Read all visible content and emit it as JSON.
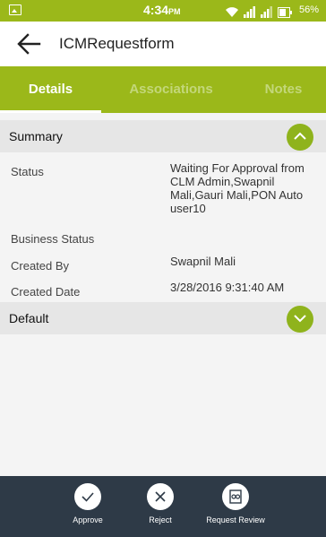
{
  "status_bar": {
    "time": "4:34",
    "ampm": "PM",
    "battery": "56%",
    "icons": [
      "image-icon",
      "wifi-icon",
      "signal-icon",
      "signal-icon",
      "battery-icon"
    ]
  },
  "app_bar": {
    "title": "ICMRequestform"
  },
  "tabs": [
    {
      "label": "Details",
      "active": true
    },
    {
      "label": "Associations",
      "active": false
    },
    {
      "label": "Notes",
      "active": false
    }
  ],
  "summary": {
    "header": "Summary",
    "fields": [
      {
        "label": "Status",
        "value": "Waiting For Approval from CLM Admin,Swapnil Mali,Gauri Mali,PON Auto user10"
      },
      {
        "label": "Business Status",
        "value": ""
      },
      {
        "label": "Created By",
        "value": "Swapnil Mali"
      },
      {
        "label": "Created Date",
        "value": "3/28/2016 9:31:40 AM"
      }
    ]
  },
  "default_section": {
    "header": "Default"
  },
  "actions": [
    {
      "label": "Approve"
    },
    {
      "label": "Reject"
    },
    {
      "label": "Request Review"
    }
  ],
  "colors": {
    "brand_green": "#9bb81a",
    "bottom_bar": "#2e3a47"
  }
}
